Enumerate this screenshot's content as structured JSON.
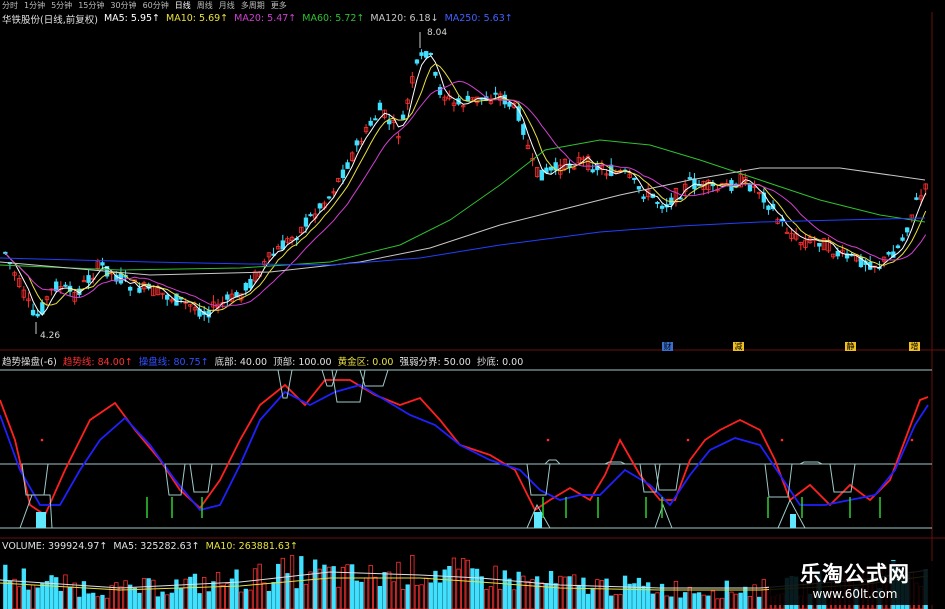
{
  "toolbar": [
    {
      "label": "分时"
    },
    {
      "label": "1分钟"
    },
    {
      "label": "5分钟"
    },
    {
      "label": "15分钟"
    },
    {
      "label": "30分钟"
    },
    {
      "label": "60分钟"
    },
    {
      "label": "日线",
      "active": true
    },
    {
      "label": "周线"
    },
    {
      "label": "月线"
    },
    {
      "label": "多周期"
    },
    {
      "label": "更多"
    }
  ],
  "main_legend": {
    "title": "华铁股份(日线,前复权)",
    "ma5": "MA5: 5.95↑",
    "ma10": "MA10: 5.69↑",
    "ma20": "MA20: 5.47↑",
    "ma60": "MA60: 5.72↑",
    "ma120": "MA120: 6.18↓",
    "ma250": "MA250: 5.63↑"
  },
  "price_high_label": "8.04",
  "price_low_label": "4.26",
  "indicator_legend": {
    "title": "趋势操盘(-6)",
    "trend": "趋势线: 84.00↑",
    "ctrl": "操盘线: 80.75↑",
    "bottom": "底部: 40.00",
    "top": "顶部: 100.00",
    "gold": "黄金区: 0.00",
    "strong": "强弱分界: 50.00",
    "buy": "抄底: 0.00"
  },
  "volume_legend": {
    "vol": "VOLUME: 399924.97↑",
    "ma5": "MA5: 325282.63↑",
    "ma10": "MA10: 263881.63↑"
  },
  "markers": [
    {
      "text": "财"
    },
    {
      "text": "减"
    },
    {
      "text": "静"
    },
    {
      "text": "增"
    }
  ],
  "watermark": {
    "line1": "乐淘公式网",
    "line2": "www.60lt.com"
  },
  "colors": {
    "up": "#ff3030",
    "down": "#40e0ff",
    "ma5": "#ffffff",
    "ma10": "#e8e040",
    "ma20": "#d040d0",
    "ma60": "#30c030",
    "ma120": "#c8c8c8",
    "ma250": "#2040ff",
    "trend": "#ff2020",
    "ctrl": "#2020ff",
    "frame": "#a0c8c8"
  }
}
